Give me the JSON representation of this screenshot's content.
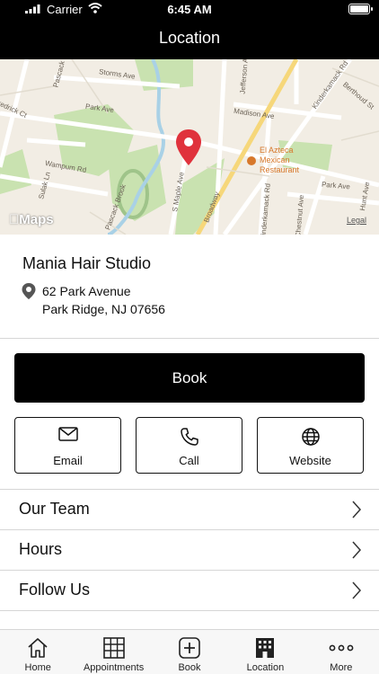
{
  "status_bar": {
    "carrier": "Carrier",
    "time": "6:45 AM"
  },
  "header": {
    "title": "Location"
  },
  "map": {
    "attribution": "Maps",
    "legal": "Legal",
    "poi_line1": "El Azteca",
    "poi_line2": "Mexican",
    "poi_line3": "Restaurant",
    "street_labels": [
      "Pascack Rd",
      "Storms Ave",
      "Park Ave",
      "Madison Ave",
      "Berthoud St",
      "Kinderkamack Rd",
      "Wampum Rd",
      "Sulak Ln",
      "Pascack Brook",
      "S Maple Ave",
      "Broadway",
      "Kinderkamack Rd",
      "Park Ave",
      "Chestnut Ave",
      "Jefferson Ave",
      "Hunt Ave",
      "Fredrick Ct"
    ]
  },
  "business": {
    "name": "Mania Hair Studio",
    "address_line1": "62 Park Avenue",
    "address_line2": "Park Ridge, NJ 07656"
  },
  "book_label": "Book",
  "actions": [
    {
      "label": "Email",
      "icon": "envelope-icon"
    },
    {
      "label": "Call",
      "icon": "phone-icon"
    },
    {
      "label": "Website",
      "icon": "globe-icon"
    }
  ],
  "menu": [
    {
      "label": "Our Team"
    },
    {
      "label": "Hours"
    },
    {
      "label": "Follow Us"
    }
  ],
  "tabs": [
    {
      "label": "Home",
      "icon": "house-icon"
    },
    {
      "label": "Appointments",
      "icon": "calendar-grid-icon"
    },
    {
      "label": "Book",
      "icon": "plus-square-icon"
    },
    {
      "label": "Location",
      "icon": "building-icon"
    },
    {
      "label": "More",
      "icon": "more-dots-icon"
    }
  ],
  "colors": {
    "header_bg": "#000000",
    "pin": "#e0323c",
    "poi": "#d7782b",
    "park": "#c9e2b0",
    "water": "#a9d1e6"
  }
}
